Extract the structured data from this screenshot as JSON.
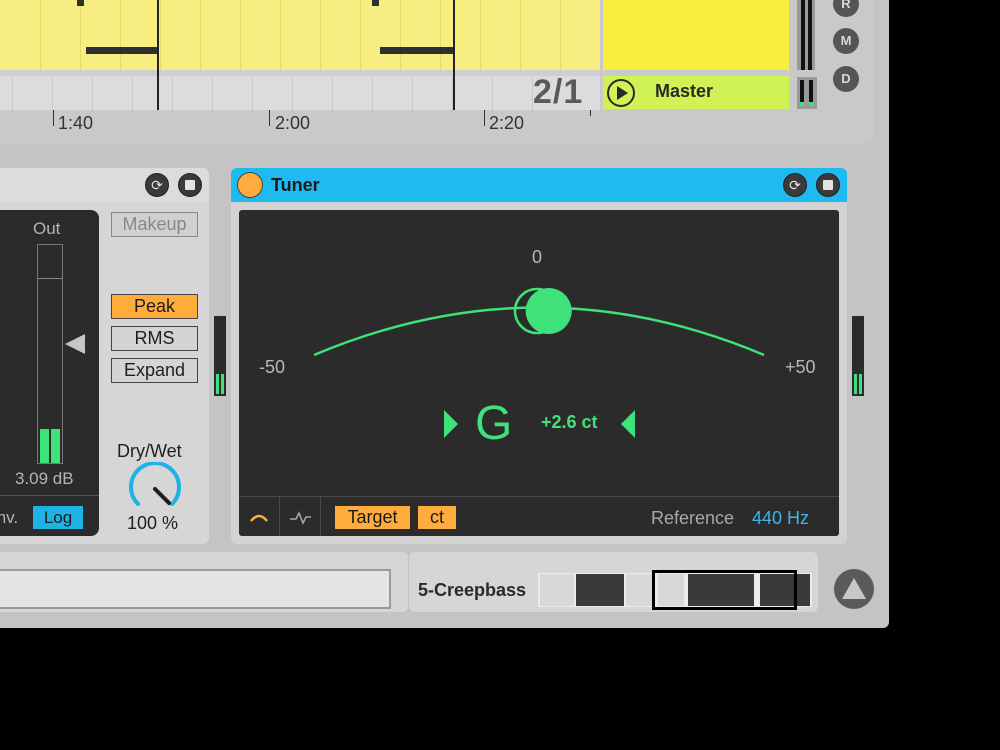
{
  "arrangement": {
    "timeline_labels": [
      "1:40",
      "2:00",
      "2:20"
    ],
    "meter": "2/1",
    "master_label": "Master",
    "side_buttons": [
      "R",
      "M",
      "D"
    ]
  },
  "compressor": {
    "out_label": "Out",
    "out_db": "3.09 dB",
    "inv_label": "Inv.",
    "log_label": "Log",
    "makeup_label": "Makeup",
    "peak_label": "Peak",
    "rms_label": "RMS",
    "expand_label": "Expand",
    "drywet_label": "Dry/Wet",
    "drywet_value": "100 %",
    "drywet_fraction": 1.0
  },
  "tuner": {
    "title": "Tuner",
    "scale_zero": "0",
    "scale_min": "-50",
    "scale_max": "+50",
    "note": "G",
    "cents": "+2.6 ct",
    "cents_value": 2.6,
    "target_label": "Target",
    "ct_label": "ct",
    "reference_label": "Reference",
    "reference_value": "440 Hz"
  },
  "bottom": {
    "track_name": "5-Creepbass"
  },
  "colors": {
    "accent_green": "#3fe27a",
    "tuner_header": "#1fbaf0",
    "orange": "#ffac3d",
    "clip_yellow": "#f7ee82",
    "master_green": "#d1f254"
  }
}
